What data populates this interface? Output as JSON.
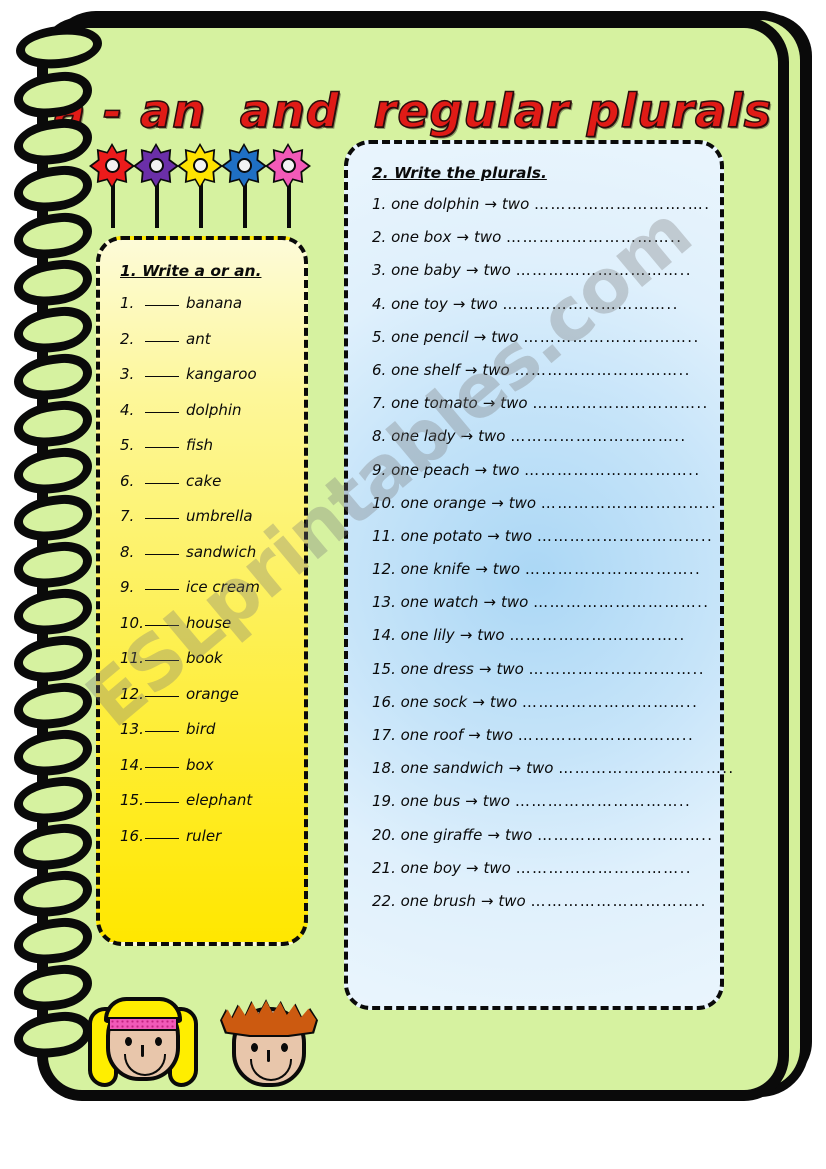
{
  "worksheet": {
    "title": "a - an  and  regular plurals",
    "title_color": "#e01b16",
    "page_color": "#d6f2a0",
    "watermark": "ESLprintables.com"
  },
  "decorations": {
    "flowers": [
      {
        "name": "flower-red",
        "color": "#ec1b1b"
      },
      {
        "name": "flower-purple",
        "color": "#6b2fa8"
      },
      {
        "name": "flower-yellow",
        "color": "#ffe300"
      },
      {
        "name": "flower-blue",
        "color": "#1f6fc4"
      },
      {
        "name": "flower-pink",
        "color": "#f25ab8"
      }
    ],
    "kids": [
      {
        "name": "girl-face",
        "hair_color": "#ffee00",
        "headband_color": "#f25ab8",
        "skin_color": "#e8c6ab"
      },
      {
        "name": "boy-face",
        "hair_color": "#cc5a10",
        "skin_color": "#e8c6ab"
      }
    ]
  },
  "exercise1": {
    "heading": "1. Write a or an.",
    "blank": "____",
    "items": [
      {
        "num": "1.",
        "word": "banana"
      },
      {
        "num": "2.",
        "word": "ant"
      },
      {
        "num": "3.",
        "word": "kangaroo"
      },
      {
        "num": "4.",
        "word": "dolphin"
      },
      {
        "num": "5.",
        "word": "fish"
      },
      {
        "num": "6.",
        "word": "cake"
      },
      {
        "num": "7.",
        "word": "umbrella"
      },
      {
        "num": "8.",
        "word": "sandwich"
      },
      {
        "num": "9.",
        "word": "ice cream"
      },
      {
        "num": "10.",
        "word": "house"
      },
      {
        "num": "11.",
        "word": "book"
      },
      {
        "num": "12.",
        "word": "orange"
      },
      {
        "num": "13.",
        "word": "bird"
      },
      {
        "num": "14.",
        "word": "box"
      },
      {
        "num": "15.",
        "word": "elephant"
      },
      {
        "num": "16.",
        "word": "ruler"
      }
    ]
  },
  "exercise2": {
    "heading": "2. Write the plurals.",
    "singular_prefix": "one",
    "arrow": "→",
    "plural_prefix": "two",
    "items": [
      {
        "num": "1.",
        "word": "dolphin",
        "dots": "……………………….…."
      },
      {
        "num": "2.",
        "word": "box",
        "dots": "………………………….."
      },
      {
        "num": "3.",
        "word": "baby",
        "dots": "………………………….."
      },
      {
        "num": "4.",
        "word": "toy",
        "dots": "………………………….."
      },
      {
        "num": "5.",
        "word": "pencil",
        "dots": "………………………….."
      },
      {
        "num": "6.",
        "word": "shelf",
        "dots": "………………………….."
      },
      {
        "num": "7.",
        "word": "tomato",
        "dots": "………………………….."
      },
      {
        "num": "8.",
        "word": "lady",
        "dots": "………………………….."
      },
      {
        "num": "9.",
        "word": "peach",
        "dots": "………………………….."
      },
      {
        "num": "10.",
        "word": "orange",
        "dots": "………………………….."
      },
      {
        "num": "11.",
        "word": "potato",
        "dots": "………………………….."
      },
      {
        "num": "12.",
        "word": "knife",
        "dots": "………………………….."
      },
      {
        "num": "13.",
        "word": "watch",
        "dots": "………………………….."
      },
      {
        "num": "14.",
        "word": "lily",
        "dots": "………………………….."
      },
      {
        "num": "15.",
        "word": "dress",
        "dots": "………………………….."
      },
      {
        "num": "16.",
        "word": "sock",
        "dots": "………………………….."
      },
      {
        "num": "17.",
        "word": "roof",
        "dots": "………………………….."
      },
      {
        "num": "18.",
        "word": "sandwich",
        "dots": "………………………….."
      },
      {
        "num": "19.",
        "word": "bus",
        "dots": "………………………….."
      },
      {
        "num": "20.",
        "word": "giraffe",
        "dots": "………………………….."
      },
      {
        "num": "21.",
        "word": "boy",
        "dots": "………………………….."
      },
      {
        "num": "22.",
        "word": "brush",
        "dots": "………………………….."
      }
    ]
  }
}
